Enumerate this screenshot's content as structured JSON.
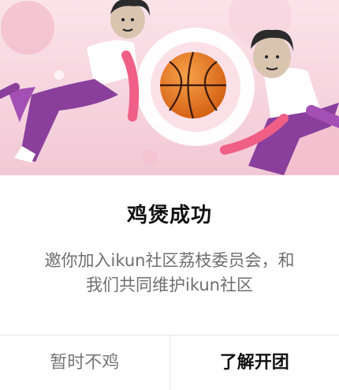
{
  "dialog": {
    "title": "鸡煲成功",
    "message_line1": "邀你加入ikun社区荔枝委员会，和",
    "message_line2": "我们共同维护ikun社区",
    "cancel_label": "暂时不鸡",
    "confirm_label": "了解开团"
  },
  "colors": {
    "hero_bg": "#f6d3de",
    "accent_purple": "#8a3f9c",
    "accent_pink": "#ef5f86",
    "ball": "#e8731e"
  },
  "icons": {
    "basketball": "basketball-icon"
  }
}
